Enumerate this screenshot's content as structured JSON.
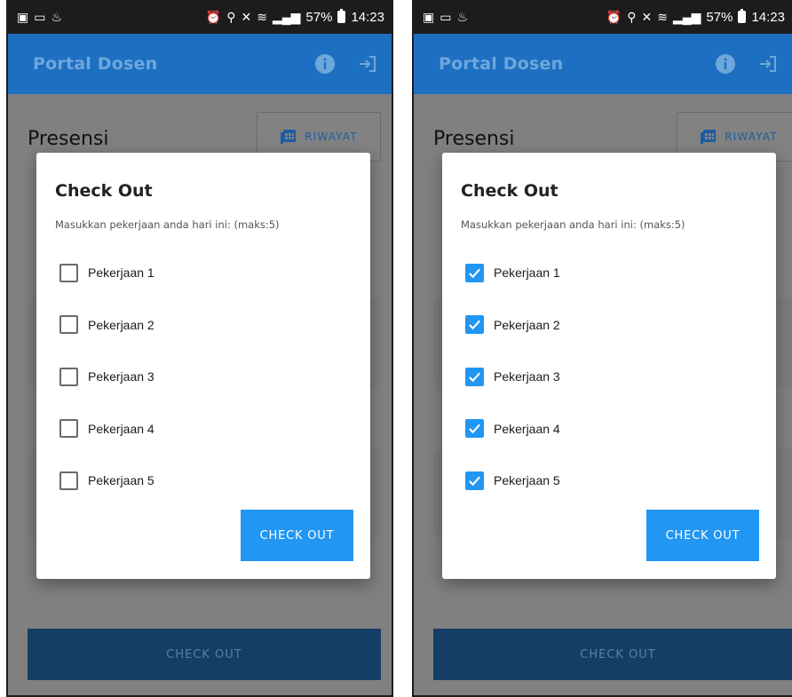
{
  "status_bar": {
    "battery": "57%",
    "time": "14:23"
  },
  "app": {
    "title": "Portal Dosen",
    "info_icon": "info-icon",
    "logout_icon": "logout-icon"
  },
  "page": {
    "title": "Presensi",
    "riwayat_label": "RIWAYAT",
    "riwayat_icon": "calendar-table-icon",
    "bottom_button": "CHECK OUT"
  },
  "dialog": {
    "title": "Check Out",
    "subtitle": "Masukkan pekerjaan anda hari ini: (maks:5)",
    "button": "CHECK OUT"
  },
  "screens": [
    {
      "tasks": [
        {
          "label": "Pekerjaan 1",
          "checked": false
        },
        {
          "label": "Pekerjaan 2",
          "checked": false
        },
        {
          "label": "Pekerjaan 3",
          "checked": false
        },
        {
          "label": "Pekerjaan 4",
          "checked": false
        },
        {
          "label": "Pekerjaan 5",
          "checked": false
        }
      ]
    },
    {
      "tasks": [
        {
          "label": "Pekerjaan 1",
          "checked": true
        },
        {
          "label": "Pekerjaan 2",
          "checked": true
        },
        {
          "label": "Pekerjaan 3",
          "checked": true
        },
        {
          "label": "Pekerjaan 4",
          "checked": true
        },
        {
          "label": "Pekerjaan 5",
          "checked": true
        }
      ]
    }
  ],
  "colors": {
    "primary": "#1d6fc1",
    "accent": "#2196f3",
    "overlay": "#808080"
  }
}
